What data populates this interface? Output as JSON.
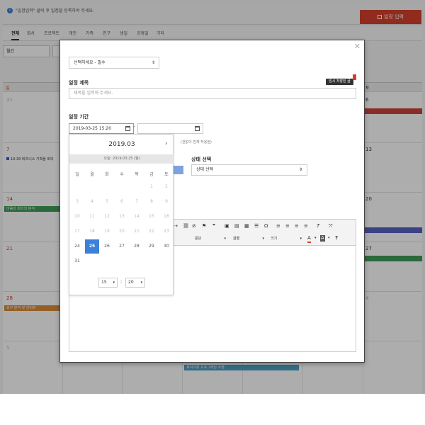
{
  "notice": {
    "text": "\"일정입력\" 클릭 후 일정을 등록하여 주세요."
  },
  "add_button": {
    "label": "일정 입력"
  },
  "category_tabs": [
    "전체",
    "회사",
    "프로젝트",
    "개인",
    "가족",
    "친구",
    "생일",
    "공휴일",
    "기타"
  ],
  "view_select": {
    "value": "월간"
  },
  "calendar": {
    "weekday_headers": [
      "일",
      "",
      "",
      "",
      "",
      "",
      "토"
    ],
    "dates": {
      "r1_sun": "31",
      "r1_sat": "6",
      "r2_sun": "7",
      "r2_sat": "13",
      "r3_sun": "14",
      "r3_sat": "20",
      "r4_sun": "21",
      "r4_sat": "27",
      "r5_sun": "28",
      "r5_sat": "4",
      "r6_sun": "5"
    },
    "events": {
      "e_r2": "10:30 비즈니스 기획을 회의",
      "e_r3": "마음의 회의의 분석",
      "e_r5": "요구 분석 및 인터뷰",
      "e_r6": "제작지향 프로그래밍 수행"
    }
  },
  "modal": {
    "type_select": {
      "value": "선택하세요 - 필수"
    },
    "title_label": "일정 제목",
    "temp_save_badge": "임시 저장된 글",
    "title_input": {
      "placeholder": "제목을 입력해 주세요."
    },
    "period_label": "일정 기간",
    "start_date": "2019-03-25 15:20",
    "date_separator": "-",
    "note_text": "(관없이 전체 적용됨)",
    "state_label": "상태 선택",
    "state_select": {
      "value": "상태 선택"
    },
    "editor": {
      "dropdowns": {
        "paragraph": "문단",
        "font": "글꼴",
        "size": "크기"
      }
    }
  },
  "datepicker": {
    "title": "2019.03",
    "today_text": "오늘: 2019.03.25 (월)",
    "weekdays": [
      "일",
      "월",
      "화",
      "수",
      "목",
      "금",
      "토"
    ],
    "weeks": [
      [
        "",
        "",
        "",
        "",
        "",
        "1",
        "2"
      ],
      [
        "3",
        "4",
        "5",
        "6",
        "7",
        "8",
        "9"
      ],
      [
        "10",
        "11",
        "12",
        "13",
        "14",
        "15",
        "16"
      ],
      [
        "17",
        "18",
        "19",
        "20",
        "21",
        "22",
        "23"
      ],
      [
        "24",
        "25",
        "26",
        "27",
        "28",
        "29",
        "30"
      ],
      [
        "31",
        "",
        "",
        "",
        "",
        "",
        ""
      ]
    ],
    "selected_day": "25",
    "enabled_from": 24,
    "hour": "15",
    "minute": "20"
  },
  "colors": {
    "accent_red": "#d5402b",
    "accent_blue": "#3b80d9",
    "event_red": "#c9453a",
    "event_green": "#3f9b57",
    "event_purple": "#5860c4",
    "event_orange": "#d98d3a",
    "event_teal": "#4a9fc4"
  }
}
